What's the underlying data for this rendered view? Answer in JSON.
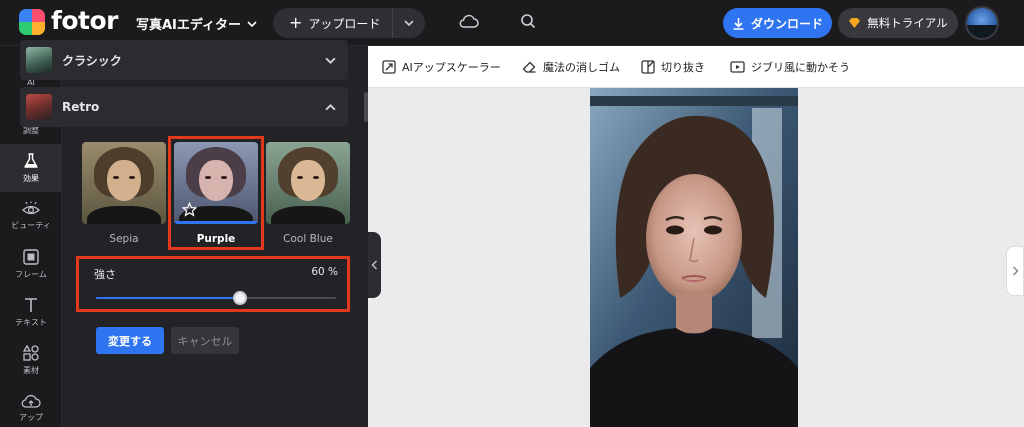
{
  "header": {
    "brand": "fotor",
    "editor_menu": "写真AIエディター",
    "upload_label": "アップロード",
    "download_label": "ダウンロード",
    "trial_label": "無料トライアル"
  },
  "rail": {
    "items": [
      {
        "label": "AI",
        "icon": "ai-wand-icon"
      },
      {
        "label": "調整",
        "icon": "sliders-icon"
      },
      {
        "label": "効果",
        "icon": "flask-icon",
        "active": true
      },
      {
        "label": "ビューティ",
        "icon": "eye-icon"
      },
      {
        "label": "フレーム",
        "icon": "frame-icon"
      },
      {
        "label": "テキスト",
        "icon": "text-icon"
      },
      {
        "label": "素材",
        "icon": "elements-icon"
      },
      {
        "label": "アップ",
        "icon": "cloud-upload-icon"
      }
    ]
  },
  "panel": {
    "sections": [
      {
        "title": "クラシック",
        "expanded": false
      },
      {
        "title": "Retro",
        "expanded": true
      }
    ],
    "filters": [
      {
        "label": "Sepia",
        "selected": false
      },
      {
        "label": "Purple",
        "selected": true
      },
      {
        "label": "Cool Blue",
        "selected": false
      }
    ],
    "strength": {
      "label": "強さ",
      "value_text": "60 %",
      "value": 0.6
    },
    "apply_label": "変更する",
    "cancel_label": "キャンセル"
  },
  "toolbar": {
    "tools": [
      {
        "label": "AIアップスケーラー",
        "icon": "ai-upscale-icon"
      },
      {
        "label": "魔法の消しゴム",
        "icon": "eraser-icon"
      },
      {
        "label": "切り抜き",
        "icon": "cutout-icon"
      },
      {
        "label": "ジブリ風に動かそう",
        "icon": "video-icon"
      }
    ]
  },
  "colors": {
    "accent": "#2f74f0",
    "highlight": "#e0391b",
    "panel_bg": "#232327",
    "canvas_bg": "#ebebed"
  }
}
